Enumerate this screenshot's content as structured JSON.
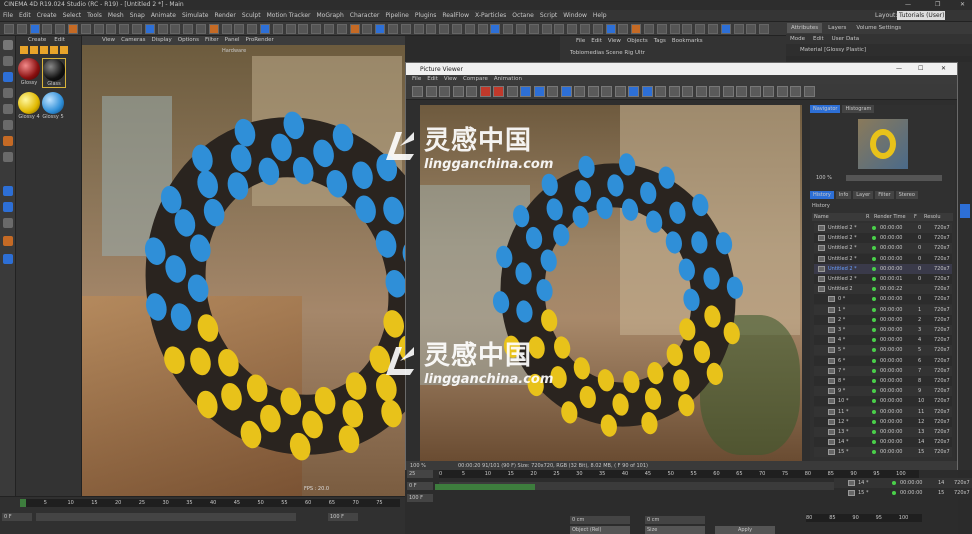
{
  "window": {
    "title": "CINEMA 4D R19.024 Studio (RC - R19) - [Untitled 2 *] - Main"
  },
  "menu": [
    "File",
    "Edit",
    "Create",
    "Select",
    "Tools",
    "Mesh",
    "Snap",
    "Animate",
    "Simulate",
    "Render",
    "Sculpt",
    "Motion Tracker",
    "MoGraph",
    "Character",
    "Pipeline",
    "Plugins",
    "RealFlow",
    "X-Particles",
    "Octane",
    "Script",
    "Window",
    "Help"
  ],
  "layout": {
    "label": "Layout:",
    "value": "Tutorials (User)"
  },
  "right_tabs": [
    "Attributes",
    "Layers",
    "Volume Settings"
  ],
  "right_menu": [
    "Mode",
    "Edit",
    "User Data"
  ],
  "material_label": "Material [Glossy Plastic]",
  "objects_menu": [
    "File",
    "Edit",
    "View",
    "Objects",
    "Tags",
    "Bookmarks"
  ],
  "objects_item": "Tobiomedias Scene Rig Ultr",
  "material_panel": {
    "menu": [
      "Create",
      "Edit"
    ],
    "materials": [
      "Glossy",
      "Glass",
      "Glossy 4",
      "Glossy 5"
    ]
  },
  "viewport": {
    "menu": [
      "View",
      "Cameras",
      "Display",
      "Options",
      "Filter",
      "Panel",
      "ProRender"
    ],
    "label": "Hardware",
    "fps": "FPS : 20.0"
  },
  "picture_viewer": {
    "title": "Picture Viewer",
    "menu": [
      "File",
      "Edit",
      "View",
      "Compare",
      "Animation"
    ],
    "zoom": "100 %",
    "status": "00:00:20 91/101 (90 F)   Size: 720x720, RGB (32 Bit), 8.02 MB, ( F 90 of 101)",
    "tabs_top": [
      "Navigator",
      "Histogram"
    ],
    "nav_zoom": "100 %",
    "tabs": [
      "History",
      "Info",
      "Layer",
      "Filter",
      "Stereo"
    ],
    "history_label": "History",
    "columns": [
      "Name",
      "R",
      "Render Time",
      "F",
      "Resolu"
    ],
    "rows": [
      {
        "name": "Untitled 2 *",
        "time": "00:00:00",
        "f": "0",
        "res": "720x7"
      },
      {
        "name": "Untitled 2 *",
        "time": "00:00:00",
        "f": "0",
        "res": "720x7"
      },
      {
        "name": "Untitled 2 *",
        "time": "00:00:00",
        "f": "0",
        "res": "720x7"
      },
      {
        "name": "Untitled 2 *",
        "time": "00:00:00",
        "f": "0",
        "res": "720x7"
      },
      {
        "name": "Untitled 2 *",
        "time": "00:00:00",
        "f": "0",
        "res": "720x7"
      },
      {
        "name": "Untitled 2 *",
        "time": "00:00:01",
        "f": "0",
        "res": "720x7"
      },
      {
        "name": "Untitled 2",
        "time": "00:00:22",
        "f": "",
        "res": "720x7"
      },
      {
        "name": "0 *",
        "time": "00:00:00",
        "f": "0",
        "res": "720x7"
      },
      {
        "name": "1 *",
        "time": "00:00:00",
        "f": "1",
        "res": "720x7"
      },
      {
        "name": "2 *",
        "time": "00:00:00",
        "f": "2",
        "res": "720x7"
      },
      {
        "name": "3 *",
        "time": "00:00:00",
        "f": "3",
        "res": "720x7"
      },
      {
        "name": "4 *",
        "time": "00:00:00",
        "f": "4",
        "res": "720x7"
      },
      {
        "name": "5 *",
        "time": "00:00:00",
        "f": "5",
        "res": "720x7"
      },
      {
        "name": "6 *",
        "time": "00:00:00",
        "f": "6",
        "res": "720x7"
      },
      {
        "name": "7 *",
        "time": "00:00:00",
        "f": "7",
        "res": "720x7"
      },
      {
        "name": "8 *",
        "time": "00:00:00",
        "f": "8",
        "res": "720x7"
      },
      {
        "name": "9 *",
        "time": "00:00:00",
        "f": "9",
        "res": "720x7"
      },
      {
        "name": "10 *",
        "time": "00:00:00",
        "f": "10",
        "res": "720x7"
      },
      {
        "name": "11 *",
        "time": "00:00:00",
        "f": "11",
        "res": "720x7"
      },
      {
        "name": "12 *",
        "time": "00:00:00",
        "f": "12",
        "res": "720x7"
      },
      {
        "name": "13 *",
        "time": "00:00:00",
        "f": "13",
        "res": "720x7"
      },
      {
        "name": "14 *",
        "time": "00:00:00",
        "f": "14",
        "res": "720x7"
      },
      {
        "name": "15 *",
        "time": "00:00:00",
        "f": "15",
        "res": "720x7"
      }
    ],
    "extra_rows": [
      {
        "name": "14 *",
        "time": "00:00:00",
        "f": "14",
        "res": "720x7"
      },
      {
        "name": "15 *",
        "time": "00:00:00",
        "f": "15",
        "res": "720x7"
      }
    ]
  },
  "timeline": {
    "ticks": [
      "0",
      "5",
      "10",
      "15",
      "20",
      "25",
      "30",
      "35",
      "40",
      "45",
      "50",
      "55",
      "60",
      "65",
      "70",
      "75",
      "80",
      "85",
      "90",
      "95",
      "100"
    ],
    "start": "25",
    "frame": "0 F",
    "end": "100 F",
    "ticks_small": [
      "80",
      "85",
      "90",
      "95",
      "100"
    ]
  },
  "bottom": {
    "ticks": [
      "0",
      "5",
      "10",
      "15",
      "20",
      "25",
      "30",
      "35",
      "40",
      "45",
      "50",
      "55",
      "60",
      "65",
      "70",
      "75"
    ],
    "frame": "0 F",
    "end": "100 F",
    "coords": [
      "0 cm",
      "0 cm",
      "0 cm",
      "0 cm",
      "0 cm",
      "0 cm"
    ],
    "dropdowns": [
      "Object (Rel)",
      "Size"
    ],
    "apply": "Apply"
  },
  "watermark": {
    "cn": "灵感中国",
    "url": "lingganchina.com"
  },
  "colors": {
    "blue": "#2f8fd8",
    "yellow": "#e8c21a",
    "ring": "#2a241f",
    "accent_green": "#3d7d3d"
  }
}
